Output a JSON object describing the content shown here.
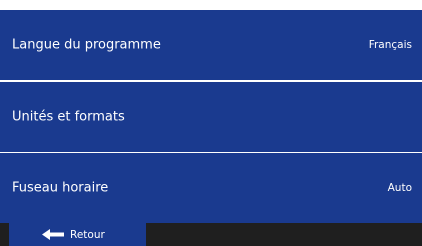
{
  "settings": {
    "rows": [
      {
        "label": "Langue du programme",
        "value": "Français"
      },
      {
        "label": "Unités et formats",
        "value": ""
      },
      {
        "label": "Fuseau horaire",
        "value": "Auto"
      }
    ]
  },
  "footer": {
    "back_label": "Retour",
    "back_icon": "arrow-left-icon"
  },
  "colors": {
    "row_background": "#1a3a8f",
    "bar_background": "#1f1f1f",
    "text": "#ffffff"
  }
}
